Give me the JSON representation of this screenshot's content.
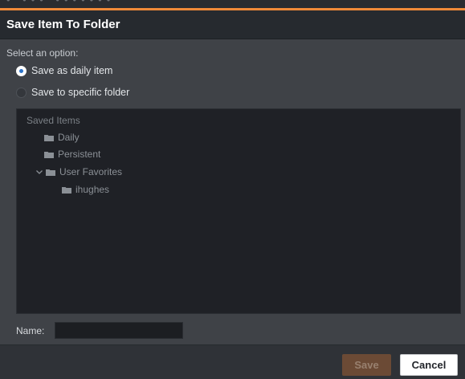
{
  "app": {
    "background_hint": "• ••• •••••••"
  },
  "dialog": {
    "title": "Save Item To Folder",
    "option_prompt": "Select an option:",
    "options": [
      {
        "label": "Save as daily item",
        "selected": true
      },
      {
        "label": "Save to specific folder",
        "selected": false
      }
    ],
    "tree": {
      "root": "Saved Items",
      "items": [
        {
          "label": "Daily",
          "expanded": false
        },
        {
          "label": "Persistent",
          "expanded": false
        },
        {
          "label": "User Favorites",
          "expanded": true
        },
        {
          "label": "ihughes",
          "expanded": false
        }
      ]
    },
    "name_label": "Name:",
    "name_value": "",
    "buttons": {
      "save": "Save",
      "cancel": "Cancel"
    }
  },
  "colors": {
    "accent": "#f08a38",
    "save_button_disabled": "#6b4a35",
    "radio_selected": "#2b73c9"
  },
  "icons": {
    "folder": "folder-icon",
    "chevron": "chevron-down-icon"
  }
}
